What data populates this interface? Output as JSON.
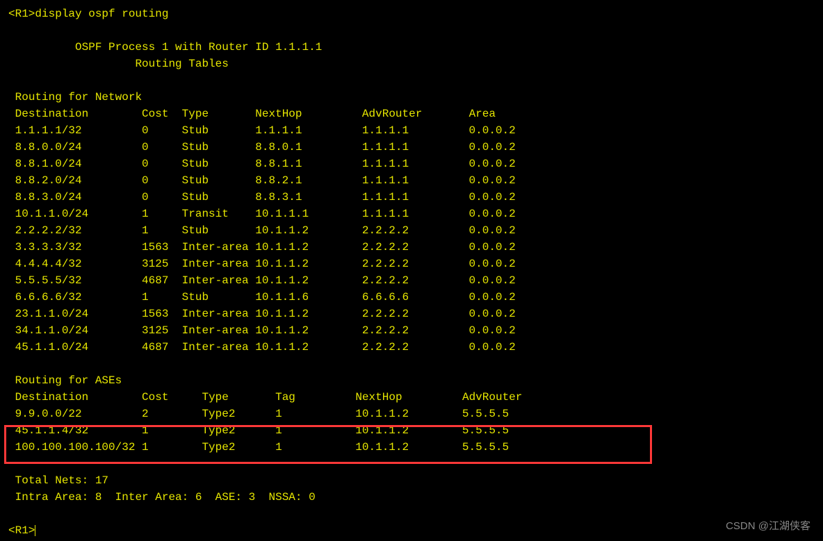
{
  "prompt_open": "<R1>",
  "command": "display ospf routing",
  "header_line1": "OSPF Process 1 with Router ID 1.1.1.1",
  "header_line2": "Routing Tables",
  "section_network": "Routing for Network",
  "net_headers": {
    "destination": "Destination",
    "cost": "Cost",
    "type": "Type",
    "nexthop": "NextHop",
    "advrouter": "AdvRouter",
    "area": "Area"
  },
  "net_rows": [
    {
      "dest": "1.1.1.1/32",
      "cost": "0",
      "type": "Stub",
      "nexthop": "1.1.1.1",
      "adv": "1.1.1.1",
      "area": "0.0.0.2"
    },
    {
      "dest": "8.8.0.0/24",
      "cost": "0",
      "type": "Stub",
      "nexthop": "8.8.0.1",
      "adv": "1.1.1.1",
      "area": "0.0.0.2"
    },
    {
      "dest": "8.8.1.0/24",
      "cost": "0",
      "type": "Stub",
      "nexthop": "8.8.1.1",
      "adv": "1.1.1.1",
      "area": "0.0.0.2"
    },
    {
      "dest": "8.8.2.0/24",
      "cost": "0",
      "type": "Stub",
      "nexthop": "8.8.2.1",
      "adv": "1.1.1.1",
      "area": "0.0.0.2"
    },
    {
      "dest": "8.8.3.0/24",
      "cost": "0",
      "type": "Stub",
      "nexthop": "8.8.3.1",
      "adv": "1.1.1.1",
      "area": "0.0.0.2"
    },
    {
      "dest": "10.1.1.0/24",
      "cost": "1",
      "type": "Transit",
      "nexthop": "10.1.1.1",
      "adv": "1.1.1.1",
      "area": "0.0.0.2"
    },
    {
      "dest": "2.2.2.2/32",
      "cost": "1",
      "type": "Stub",
      "nexthop": "10.1.1.2",
      "adv": "2.2.2.2",
      "area": "0.0.0.2"
    },
    {
      "dest": "3.3.3.3/32",
      "cost": "1563",
      "type": "Inter-area",
      "nexthop": "10.1.1.2",
      "adv": "2.2.2.2",
      "area": "0.0.0.2"
    },
    {
      "dest": "4.4.4.4/32",
      "cost": "3125",
      "type": "Inter-area",
      "nexthop": "10.1.1.2",
      "adv": "2.2.2.2",
      "area": "0.0.0.2"
    },
    {
      "dest": "5.5.5.5/32",
      "cost": "4687",
      "type": "Inter-area",
      "nexthop": "10.1.1.2",
      "adv": "2.2.2.2",
      "area": "0.0.0.2"
    },
    {
      "dest": "6.6.6.6/32",
      "cost": "1",
      "type": "Stub",
      "nexthop": "10.1.1.6",
      "adv": "6.6.6.6",
      "area": "0.0.0.2"
    },
    {
      "dest": "23.1.1.0/24",
      "cost": "1563",
      "type": "Inter-area",
      "nexthop": "10.1.1.2",
      "adv": "2.2.2.2",
      "area": "0.0.0.2"
    },
    {
      "dest": "34.1.1.0/24",
      "cost": "3125",
      "type": "Inter-area",
      "nexthop": "10.1.1.2",
      "adv": "2.2.2.2",
      "area": "0.0.0.2"
    },
    {
      "dest": "45.1.1.0/24",
      "cost": "4687",
      "type": "Inter-area",
      "nexthop": "10.1.1.2",
      "adv": "2.2.2.2",
      "area": "0.0.0.2"
    }
  ],
  "section_ases": "Routing for ASEs",
  "ase_headers": {
    "destination": "Destination",
    "cost": "Cost",
    "type": "Type",
    "tag": "Tag",
    "nexthop": "NextHop",
    "advrouter": "AdvRouter"
  },
  "ase_rows": [
    {
      "dest": "9.9.0.0/22",
      "cost": "2",
      "type": "Type2",
      "tag": "1",
      "nexthop": "10.1.1.2",
      "adv": "5.5.5.5"
    },
    {
      "dest": "45.1.1.4/32",
      "cost": "1",
      "type": "Type2",
      "tag": "1",
      "nexthop": "10.1.1.2",
      "adv": "5.5.5.5"
    },
    {
      "dest": "100.100.100.100/32",
      "cost": "1",
      "type": "Type2",
      "tag": "1",
      "nexthop": "10.1.1.2",
      "adv": "5.5.5.5"
    }
  ],
  "totals": {
    "total_nets": "Total Nets: 17",
    "intra_area": "Intra Area: 8",
    "inter_area": "Inter Area: 6",
    "ase": "ASE: 3",
    "nssa": "NSSA: 0"
  },
  "prompt_close": "<R1>",
  "watermark": "CSDN @江湖侠客"
}
